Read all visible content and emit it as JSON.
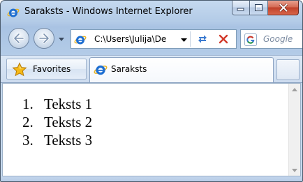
{
  "window": {
    "title": "Saraksts - Windows Internet Explorer"
  },
  "navigation": {
    "address": "C:\\Users\\Julija\\De",
    "search_placeholder": "Google"
  },
  "tabbar": {
    "favorites_label": "Favorites",
    "active_tab_label": "Saraksts"
  },
  "page": {
    "list": [
      {
        "number": "1.",
        "text": "Teksts 1"
      },
      {
        "number": "2.",
        "text": "Teksts 2"
      },
      {
        "number": "3.",
        "text": "Teksts 3"
      }
    ]
  },
  "colors": {
    "frame": "#bcd2ec",
    "close_button": "#c7442c",
    "ie_logo": "#1f6fd1",
    "favorites_star": "#f5b916"
  },
  "icons": {
    "browser": "ie-icon",
    "back": "arrow-left-icon",
    "forward": "arrow-right-icon",
    "refresh": "refresh-icon",
    "stop": "stop-icon",
    "search": "google-icon",
    "favorites": "star-icon"
  }
}
